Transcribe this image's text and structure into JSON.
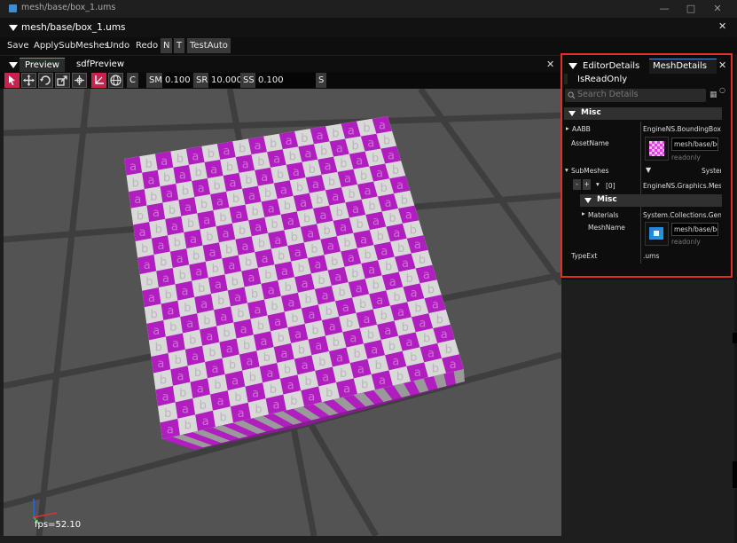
{
  "window": {
    "title": "mesh/base/box_1.ums",
    "minimize_glyph": "—",
    "maximize_glyph": "□",
    "close_glyph": "✕",
    "icon": "app-icon"
  },
  "document": {
    "title": "mesh/base/box_1.ums",
    "close_glyph": "✕"
  },
  "toolbar": {
    "save": "Save",
    "apply_submeshes": "ApplySubMeshes",
    "undo": "Undo",
    "redo": "Redo",
    "n": "N",
    "t": "T",
    "test_auto": "TestAuto"
  },
  "viewport_tabs": {
    "preview": "Preview",
    "sdf_preview": "sdfPreview",
    "close_glyph": "✕"
  },
  "viewport_toolbar": {
    "icons": [
      "select-icon",
      "move-icon",
      "rotate-icon",
      "scale-icon",
      "snap-icon",
      "axis-icon",
      "globe-icon"
    ],
    "c": "C",
    "sm_label": "SM",
    "sm_value": "0.100",
    "sr_label": "SR",
    "sr_value": "10.000",
    "ss_label": "SS",
    "ss_value": "0.100",
    "s": "S"
  },
  "viewport": {
    "fps": "fps=52.10",
    "cube_colors": {
      "magenta": "#b01ebf",
      "light": "#d9d9d9"
    },
    "checker_letters": [
      "a",
      "b"
    ]
  },
  "details_panel": {
    "tabs": [
      "EditorDetails",
      "MeshDetails"
    ],
    "close_glyph": "✕",
    "is_readonly": "IsReadOnly",
    "search_placeholder": "Search Details",
    "section_misc": "Misc",
    "rows": {
      "aabb_label": "AABB",
      "aabb_value": "EngineNS.BoundingBox@E",
      "asset_name_label": "AssetName",
      "asset_name_value": "mesh/base/bo",
      "asset_readonly": "readonly",
      "submeshes_label": "SubMeshes",
      "submeshes_value": "System",
      "sub_minus": "-",
      "sub_plus": "+",
      "sub_index": "[0]",
      "sub_index_value": "EngineNS.Graphics.Mesh.T",
      "sub_section_misc": "Misc",
      "materials_label": "Materials",
      "materials_value": "System.Collections.Generic",
      "mesh_name_label": "MeshName",
      "mesh_name_value": "mesh/base/bo",
      "mesh_readonly": "readonly",
      "type_ext_label": "TypeExt",
      "type_ext_value": ".ums"
    },
    "highlight_color": "#e03020"
  }
}
